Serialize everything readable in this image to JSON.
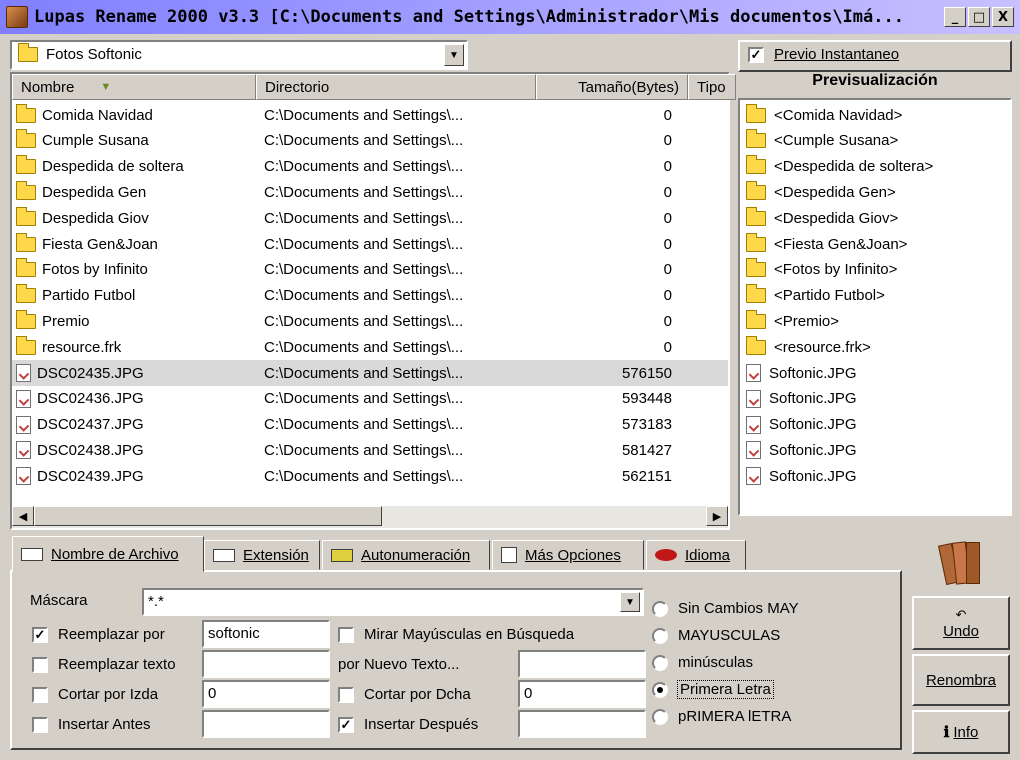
{
  "window": {
    "title": "Lupas Rename 2000 v3.3  [C:\\Documents and Settings\\Administrador\\Mis documentos\\Imá...",
    "minimize": "_",
    "maximize": "□",
    "close": "X"
  },
  "folder_combo": {
    "value": "Fotos Softonic"
  },
  "list": {
    "headers": {
      "name": "Nombre",
      "dir": "Directorio",
      "size": "Tamaño(Bytes)",
      "type": "Tipo"
    },
    "rows": [
      {
        "name": "Comida Navidad",
        "dir": "C:\\Documents and Settings\\...",
        "size": "0",
        "kind": "folder"
      },
      {
        "name": "Cumple Susana",
        "dir": "C:\\Documents and Settings\\...",
        "size": "0",
        "kind": "folder"
      },
      {
        "name": "Despedida de soltera",
        "dir": "C:\\Documents and Settings\\...",
        "size": "0",
        "kind": "folder"
      },
      {
        "name": "Despedida Gen",
        "dir": "C:\\Documents and Settings\\...",
        "size": "0",
        "kind": "folder"
      },
      {
        "name": "Despedida Giov",
        "dir": "C:\\Documents and Settings\\...",
        "size": "0",
        "kind": "folder"
      },
      {
        "name": "Fiesta Gen&Joan",
        "dir": "C:\\Documents and Settings\\...",
        "size": "0",
        "kind": "folder"
      },
      {
        "name": "Fotos by Infinito",
        "dir": "C:\\Documents and Settings\\...",
        "size": "0",
        "kind": "folder"
      },
      {
        "name": "Partido Futbol",
        "dir": "C:\\Documents and Settings\\...",
        "size": "0",
        "kind": "folder"
      },
      {
        "name": "Premio",
        "dir": "C:\\Documents and Settings\\...",
        "size": "0",
        "kind": "folder"
      },
      {
        "name": "resource.frk",
        "dir": "C:\\Documents and Settings\\...",
        "size": "0",
        "kind": "folder"
      },
      {
        "name": "DSC02435.JPG",
        "dir": "C:\\Documents and Settings\\...",
        "size": "576150",
        "kind": "file",
        "selected": true
      },
      {
        "name": "DSC02436.JPG",
        "dir": "C:\\Documents and Settings\\...",
        "size": "593448",
        "kind": "file"
      },
      {
        "name": "DSC02437.JPG",
        "dir": "C:\\Documents and Settings\\...",
        "size": "573183",
        "kind": "file"
      },
      {
        "name": "DSC02438.JPG",
        "dir": "C:\\Documents and Settings\\...",
        "size": "581427",
        "kind": "file"
      },
      {
        "name": "DSC02439.JPG",
        "dir": "C:\\Documents and Settings\\...",
        "size": "562151",
        "kind": "file"
      }
    ]
  },
  "preview": {
    "instant_label": "Previo Instantaneo",
    "instant_checked": true,
    "title": "Previsualización",
    "items": [
      {
        "name": "<Comida Navidad>",
        "kind": "folder"
      },
      {
        "name": "<Cumple Susana>",
        "kind": "folder"
      },
      {
        "name": "<Despedida de soltera>",
        "kind": "folder"
      },
      {
        "name": "<Despedida Gen>",
        "kind": "folder"
      },
      {
        "name": "<Despedida Giov>",
        "kind": "folder"
      },
      {
        "name": "<Fiesta Gen&Joan>",
        "kind": "folder"
      },
      {
        "name": "<Fotos by Infinito>",
        "kind": "folder"
      },
      {
        "name": "<Partido Futbol>",
        "kind": "folder"
      },
      {
        "name": "<Premio>",
        "kind": "folder"
      },
      {
        "name": "<resource.frk>",
        "kind": "folder"
      },
      {
        "name": "Softonic.JPG",
        "kind": "file"
      },
      {
        "name": "Softonic.JPG",
        "kind": "file"
      },
      {
        "name": "Softonic.JPG",
        "kind": "file"
      },
      {
        "name": "Softonic.JPG",
        "kind": "file"
      },
      {
        "name": "Softonic.JPG",
        "kind": "file"
      }
    ]
  },
  "tabs": {
    "nombre": "Nombre de Archivo",
    "extension": "Extensión",
    "autonum": "Autonumeración",
    "mas": "Más Opciones",
    "idioma": "Idioma"
  },
  "form": {
    "mascara_label": "Máscara",
    "mascara_value": "*.*",
    "reemplazar_por": {
      "label": "Reemplazar por",
      "checked": true,
      "value": "softonic"
    },
    "reemplazar_texto": {
      "label": "Reemplazar texto",
      "checked": false,
      "value": ""
    },
    "cortar_izda": {
      "label": "Cortar por Izda",
      "checked": false,
      "value": "0"
    },
    "insertar_antes": {
      "label": "Insertar Antes",
      "checked": false,
      "value": ""
    },
    "mirar_mayusculas": {
      "label": "Mirar Mayúsculas en Búsqueda",
      "checked": false
    },
    "por_nuevo_texto": {
      "label": "por Nuevo Texto...",
      "value": ""
    },
    "cortar_dcha": {
      "label": "Cortar por Dcha",
      "checked": false,
      "value": "0"
    },
    "insertar_despues": {
      "label": "Insertar Después",
      "checked": true,
      "value": ""
    },
    "case_options": [
      {
        "label": "Sin Cambios MAY",
        "checked": false
      },
      {
        "label": "MAYUSCULAS",
        "checked": false
      },
      {
        "label": "minúsculas",
        "checked": false
      },
      {
        "label": "Primera Letra",
        "checked": true
      },
      {
        "label": "pRIMERA lETRA",
        "checked": false
      }
    ]
  },
  "buttons": {
    "undo": "Undo",
    "renombra": "Renombra",
    "info": "Info"
  }
}
